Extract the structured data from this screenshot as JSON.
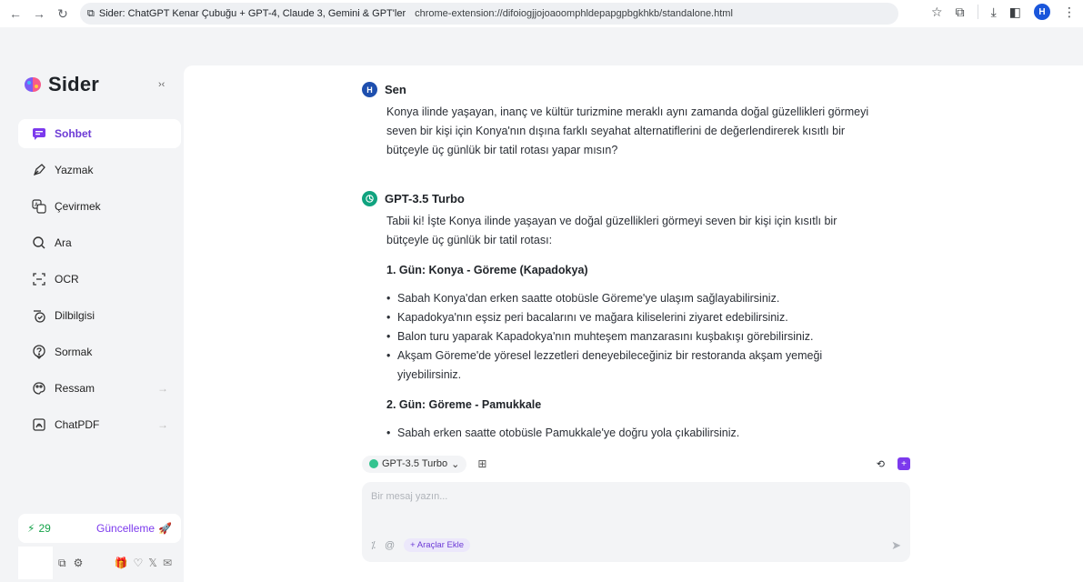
{
  "browser": {
    "tab_title": "Sider: ChatGPT Kenar Çubuğu + GPT-4, Claude 3, Gemini & GPT'ler",
    "url": "chrome-extension://difoiogjjojoaoomphldepapgpbgkhkb/standalone.html",
    "profile_initial": "H",
    "icons": [
      "back-icon",
      "forward-icon",
      "reload-icon",
      "extension-icon",
      "star-icon",
      "puzzle-icon",
      "download-icon",
      "sidepanel-icon",
      "menu-icon"
    ]
  },
  "sidebar": {
    "brand": "Sider",
    "collapse_glyph": "›‹",
    "items": [
      {
        "label": "Sohbet",
        "icon": "chat-icon"
      },
      {
        "label": "Yazmak",
        "icon": "pen-icon"
      },
      {
        "label": "Çevirmek",
        "icon": "translate-icon"
      },
      {
        "label": "Ara",
        "icon": "search-icon"
      },
      {
        "label": "OCR",
        "icon": "ocr-icon"
      },
      {
        "label": "Dilbilgisi",
        "icon": "grammar-icon"
      },
      {
        "label": "Sormak",
        "icon": "question-icon"
      },
      {
        "label": "Ressam",
        "icon": "palette-icon"
      },
      {
        "label": "ChatPDF",
        "icon": "pdf-icon"
      }
    ],
    "credits": "29",
    "update_label": "Güncelleme",
    "accent": "#6d3bd6"
  },
  "chat": {
    "user_name": "Sen",
    "user_initial": "H",
    "user_message": "Konya ilinde yaşayan, inanç ve kültür turizmine meraklı aynı zamanda doğal güzellikleri görmeyi seven bir kişi için Konya'nın dışına farklı seyahat alternatiflerini de değerlendirerek kısıtlı bir bütçeyle üç günlük bir tatil rotası yapar mısın?",
    "bot_name": "GPT-3.5 Turbo",
    "bot_intro": "Tabii ki! İşte Konya ilinde yaşayan ve doğal güzellikleri görmeyi seven bir kişi için kısıtlı bir bütçeyle üç günlük bir tatil rotası:",
    "day1_title": "1. Gün: Konya - Göreme (Kapadokya)",
    "day1_items": [
      "Sabah Konya'dan erken saatte otobüsle Göreme'ye ulaşım sağlayabilirsiniz.",
      "Kapadokya'nın eşsiz peri bacalarını ve mağara kiliselerini ziyaret edebilirsiniz.",
      "Balon turu yaparak Kapadokya'nın muhteşem manzarasını kuşbakışı görebilirsiniz.",
      "Akşam Göreme'de yöresel lezzetleri deneyebileceğiniz bir restoranda akşam yemeği yiyebilirsiniz."
    ],
    "day2_title": "2. Gün: Göreme - Pamukkale",
    "day2_items": [
      "Sabah erken saatte otobüsle Pamukkale'ye doğru yola çıkabilirsiniz."
    ]
  },
  "composer": {
    "model_label": "GPT-3.5 Turbo",
    "placeholder": "Bir mesaj yazın...",
    "tools_label": "+ Araçlar Ekle",
    "at_glyph": "@"
  }
}
